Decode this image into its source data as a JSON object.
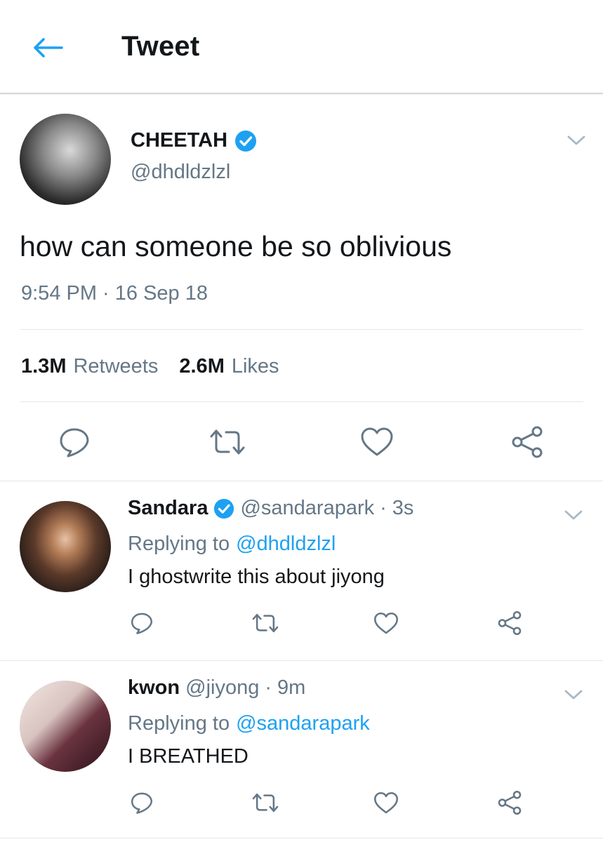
{
  "colors": {
    "accent": "#1da1f2",
    "text": "#14171a",
    "muted": "#657786",
    "divider": "#e1e8ed"
  },
  "header": {
    "title": "Tweet",
    "back_icon": "arrow-left-icon"
  },
  "tweet": {
    "name": "CHEETAH",
    "handle": "@dhdldzlzl",
    "verified": true,
    "text": "how can someone be so oblivious",
    "timestamp": "9:54 PM · 16 Sep 18",
    "retweets_count": "1.3M",
    "retweets_label": "Retweets",
    "likes_count": "2.6M",
    "likes_label": "Likes",
    "actions": [
      "reply-icon",
      "retweet-icon",
      "like-icon",
      "share-icon"
    ]
  },
  "replies": [
    {
      "name": "Sandara",
      "verified": true,
      "handle": "@sandarapark",
      "dot": "·",
      "time": "3s",
      "replying_prefix": "Replying to",
      "replying_to": "@dhdldzlzl",
      "text": "I ghostwrite this about jiyong"
    },
    {
      "name": "kwon",
      "verified": false,
      "handle": "@jiyong",
      "dot": "·",
      "time": "9m",
      "replying_prefix": "Replying to",
      "replying_to": "@sandarapark",
      "text": "I BREATHED"
    }
  ]
}
